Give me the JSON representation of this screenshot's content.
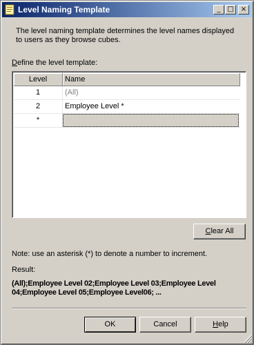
{
  "window": {
    "title": "Level Naming Template",
    "controls": {
      "minimize": "_",
      "maximize": "□",
      "close": "×"
    }
  },
  "description_line1": "The level naming template determines the level names displayed",
  "description_line2": "to users as they browse cubes.",
  "define_label_first": "D",
  "define_label_rest": "efine the level template:",
  "grid": {
    "columns": [
      "Level",
      "Name"
    ],
    "rows": [
      {
        "level": "1",
        "name": "(All)"
      },
      {
        "level": "2",
        "name": "Employee Level *"
      },
      {
        "level": "*",
        "name": ""
      }
    ]
  },
  "clear_all": {
    "first": "C",
    "rest": "lear All"
  },
  "note": "Note: use an asterisk (*) to denote a number to increment.",
  "result_label": "Result:",
  "result_line1": "(All);Employee Level 02;Employee Level 03;Employee Level",
  "result_line2": "04;Employee Level 05;Employee Level06; ...",
  "buttons": {
    "ok": "OK",
    "cancel": "Cancel",
    "help_first": "H",
    "help_rest": "elp"
  },
  "colors": {
    "title_start": "#0a246a",
    "title_end": "#a6caf0",
    "face": "#d4d0c8",
    "disabled_text": "#808080"
  },
  "icons": {
    "title": "template-document-icon",
    "resize": "size-grip-icon"
  }
}
